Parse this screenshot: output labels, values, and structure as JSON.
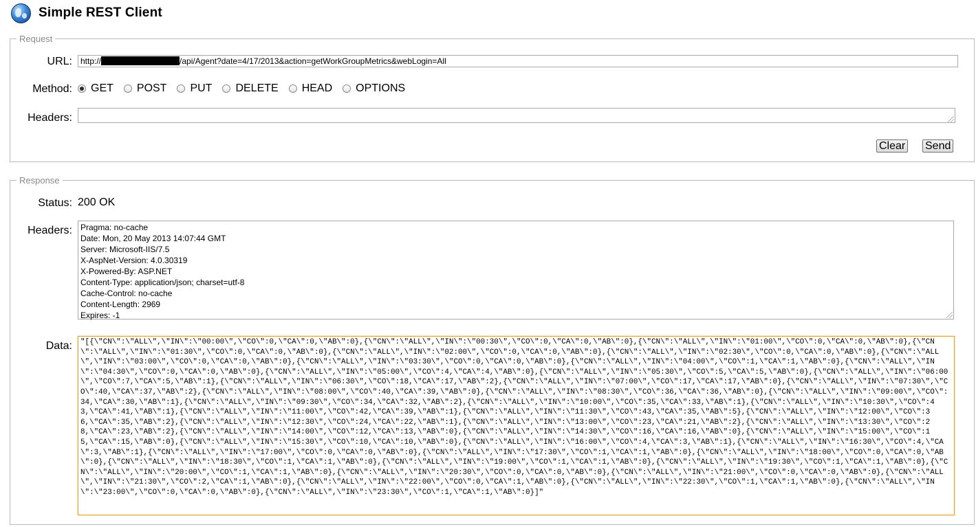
{
  "app": {
    "title": "Simple REST Client"
  },
  "request": {
    "legend": "Request",
    "url_label": "URL:",
    "url_prefix": "http://",
    "url_suffix": "/api/Agent?date=4/17/2013&action=getWorkGroupMetrics&webLogin=All",
    "method_label": "Method:",
    "methods": [
      {
        "label": "GET",
        "selected": true
      },
      {
        "label": "POST",
        "selected": false
      },
      {
        "label": "PUT",
        "selected": false
      },
      {
        "label": "DELETE",
        "selected": false
      },
      {
        "label": "HEAD",
        "selected": false
      },
      {
        "label": "OPTIONS",
        "selected": false
      }
    ],
    "headers_label": "Headers:",
    "headers_value": "",
    "clear_label": "Clear",
    "send_label": "Send"
  },
  "response": {
    "legend": "Response",
    "status_label": "Status:",
    "status_value": "200 OK",
    "headers_label": "Headers:",
    "headers": [
      "Pragma: no-cache",
      "Date: Mon, 20 May 2013 14:07:44 GMT",
      "Server: Microsoft-IIS/7.5",
      "X-AspNet-Version: 4.0.30319",
      "X-Powered-By: ASP.NET",
      "Content-Type: application/json; charset=utf-8",
      "Cache-Control: no-cache",
      "Content-Length: 2969",
      "Expires: -1"
    ],
    "data_label": "Data:",
    "data": "\"[{\\\"CN\\\":\\\"ALL\\\",\\\"IN\\\":\\\"00:00\\\",\\\"CO\\\":0,\\\"CA\\\":0,\\\"AB\\\":0},{\\\"CN\\\":\\\"ALL\\\",\\\"IN\\\":\\\"00:30\\\",\\\"CO\\\":0,\\\"CA\\\":0,\\\"AB\\\":0},{\\\"CN\\\":\\\"ALL\\\",\\\"IN\\\":\\\"01:00\\\",\\\"CO\\\":0,\\\"CA\\\":0,\\\"AB\\\":0},{\\\"CN\\\":\\\"ALL\\\",\\\"IN\\\":\\\"01:30\\\",\\\"CO\\\":0,\\\"CA\\\":0,\\\"AB\\\":0},{\\\"CN\\\":\\\"ALL\\\",\\\"IN\\\":\\\"02:00\\\",\\\"CO\\\":0,\\\"CA\\\":0,\\\"AB\\\":0},{\\\"CN\\\":\\\"ALL\\\",\\\"IN\\\":\\\"02:30\\\",\\\"CO\\\":0,\\\"CA\\\":0,\\\"AB\\\":0},{\\\"CN\\\":\\\"ALL\\\",\\\"IN\\\":\\\"03:00\\\",\\\"CO\\\":0,\\\"CA\\\":0,\\\"AB\\\":0},{\\\"CN\\\":\\\"ALL\\\",\\\"IN\\\":\\\"03:30\\\",\\\"CO\\\":0,\\\"CA\\\":0,\\\"AB\\\":0},{\\\"CN\\\":\\\"ALL\\\",\\\"IN\\\":\\\"04:00\\\",\\\"CO\\\":1,\\\"CA\\\":1,\\\"AB\\\":0},{\\\"CN\\\":\\\"ALL\\\",\\\"IN\\\":\\\"04:30\\\",\\\"CO\\\":0,\\\"CA\\\":0,\\\"AB\\\":0},{\\\"CN\\\":\\\"ALL\\\",\\\"IN\\\":\\\"05:00\\\",\\\"CO\\\":4,\\\"CA\\\":4,\\\"AB\\\":0},{\\\"CN\\\":\\\"ALL\\\",\\\"IN\\\":\\\"05:30\\\",\\\"CO\\\":5,\\\"CA\\\":5,\\\"AB\\\":0},{\\\"CN\\\":\\\"ALL\\\",\\\"IN\\\":\\\"06:00\\\",\\\"CO\\\":7,\\\"CA\\\":5,\\\"AB\\\":1},{\\\"CN\\\":\\\"ALL\\\",\\\"IN\\\":\\\"06:30\\\",\\\"CO\\\":18,\\\"CA\\\":17,\\\"AB\\\":2},{\\\"CN\\\":\\\"ALL\\\",\\\"IN\\\":\\\"07:00\\\",\\\"CO\\\":17,\\\"CA\\\":17,\\\"AB\\\":0},{\\\"CN\\\":\\\"ALL\\\",\\\"IN\\\":\\\"07:30\\\",\\\"CO\\\":40,\\\"CA\\\":37,\\\"AB\\\":2},{\\\"CN\\\":\\\"ALL\\\",\\\"IN\\\":\\\"08:00\\\",\\\"CO\\\":40,\\\"CA\\\":39,\\\"AB\\\":0},{\\\"CN\\\":\\\"ALL\\\",\\\"IN\\\":\\\"08:30\\\",\\\"CO\\\":36,\\\"CA\\\":36,\\\"AB\\\":0},{\\\"CN\\\":\\\"ALL\\\",\\\"IN\\\":\\\"09:00\\\",\\\"CO\\\":34,\\\"CA\\\":30,\\\"AB\\\":1},{\\\"CN\\\":\\\"ALL\\\",\\\"IN\\\":\\\"09:30\\\",\\\"CO\\\":34,\\\"CA\\\":32,\\\"AB\\\":2},{\\\"CN\\\":\\\"ALL\\\",\\\"IN\\\":\\\"10:00\\\",\\\"CO\\\":35,\\\"CA\\\":33,\\\"AB\\\":1},{\\\"CN\\\":\\\"ALL\\\",\\\"IN\\\":\\\"10:30\\\",\\\"CO\\\":43,\\\"CA\\\":41,\\\"AB\\\":1},{\\\"CN\\\":\\\"ALL\\\",\\\"IN\\\":\\\"11:00\\\",\\\"CO\\\":42,\\\"CA\\\":39,\\\"AB\\\":1},{\\\"CN\\\":\\\"ALL\\\",\\\"IN\\\":\\\"11:30\\\",\\\"CO\\\":43,\\\"CA\\\":35,\\\"AB\\\":5},{\\\"CN\\\":\\\"ALL\\\",\\\"IN\\\":\\\"12:00\\\",\\\"CO\\\":36,\\\"CA\\\":35,\\\"AB\\\":2},{\\\"CN\\\":\\\"ALL\\\",\\\"IN\\\":\\\"12:30\\\",\\\"CO\\\":24,\\\"CA\\\":22,\\\"AB\\\":1},{\\\"CN\\\":\\\"ALL\\\",\\\"IN\\\":\\\"13:00\\\",\\\"CO\\\":23,\\\"CA\\\":21,\\\"AB\\\":2},{\\\"CN\\\":\\\"ALL\\\",\\\"IN\\\":\\\"13:30\\\",\\\"CO\\\":28,\\\"CA\\\":23,\\\"AB\\\":2},{\\\"CN\\\":\\\"ALL\\\",\\\"IN\\\":\\\"14:00\\\",\\\"CO\\\":12,\\\"CA\\\":13,\\\"AB\\\":0},{\\\"CN\\\":\\\"ALL\\\",\\\"IN\\\":\\\"14:30\\\",\\\"CO\\\":16,\\\"CA\\\":16,\\\"AB\\\":0},{\\\"CN\\\":\\\"ALL\\\",\\\"IN\\\":\\\"15:00\\\",\\\"CO\\\":15,\\\"CA\\\":15,\\\"AB\\\":0},{\\\"CN\\\":\\\"ALL\\\",\\\"IN\\\":\\\"15:30\\\",\\\"CO\\\":10,\\\"CA\\\":10,\\\"AB\\\":0},{\\\"CN\\\":\\\"ALL\\\",\\\"IN\\\":\\\"16:00\\\",\\\"CO\\\":4,\\\"CA\\\":3,\\\"AB\\\":1},{\\\"CN\\\":\\\"ALL\\\",\\\"IN\\\":\\\"16:30\\\",\\\"CO\\\":4,\\\"CA\\\":3,\\\"AB\\\":1},{\\\"CN\\\":\\\"ALL\\\",\\\"IN\\\":\\\"17:00\\\",\\\"CO\\\":0,\\\"CA\\\":0,\\\"AB\\\":0},{\\\"CN\\\":\\\"ALL\\\",\\\"IN\\\":\\\"17:30\\\",\\\"CO\\\":1,\\\"CA\\\":1,\\\"AB\\\":0},{\\\"CN\\\":\\\"ALL\\\",\\\"IN\\\":\\\"18:00\\\",\\\"CO\\\":0,\\\"CA\\\":0,\\\"AB\\\":0},{\\\"CN\\\":\\\"ALL\\\",\\\"IN\\\":\\\"18:30\\\",\\\"CO\\\":1,\\\"CA\\\":1,\\\"AB\\\":0},{\\\"CN\\\":\\\"ALL\\\",\\\"IN\\\":\\\"19:00\\\",\\\"CO\\\":1,\\\"CA\\\":1,\\\"AB\\\":0},{\\\"CN\\\":\\\"ALL\\\",\\\"IN\\\":\\\"19:30\\\",\\\"CO\\\":1,\\\"CA\\\":1,\\\"AB\\\":0},{\\\"CN\\\":\\\"ALL\\\",\\\"IN\\\":\\\"20:00\\\",\\\"CO\\\":1,\\\"CA\\\":1,\\\"AB\\\":0},{\\\"CN\\\":\\\"ALL\\\",\\\"IN\\\":\\\"20:30\\\",\\\"CO\\\":0,\\\"CA\\\":0,\\\"AB\\\":0},{\\\"CN\\\":\\\"ALL\\\",\\\"IN\\\":\\\"21:00\\\",\\\"CO\\\":0,\\\"CA\\\":0,\\\"AB\\\":0},{\\\"CN\\\":\\\"ALL\\\",\\\"IN\\\":\\\"21:30\\\",\\\"CO\\\":2,\\\"CA\\\":1,\\\"AB\\\":0},{\\\"CN\\\":\\\"ALL\\\",\\\"IN\\\":\\\"22:00\\\",\\\"CO\\\":0,\\\"CA\\\":1,\\\"AB\\\":0},{\\\"CN\\\":\\\"ALL\\\",\\\"IN\\\":\\\"22:30\\\",\\\"CO\\\":1,\\\"CA\\\":1,\\\"AB\\\":0},{\\\"CN\\\":\\\"ALL\\\",\\\"IN\\\":\\\"23:00\\\",\\\"CO\\\":0,\\\"CA\\\":0,\\\"AB\\\":0},{\\\"CN\\\":\\\"ALL\\\",\\\"IN\\\":\\\"23:30\\\",\\\"CO\\\":1,\\\"CA\\\":1,\\\"AB\\\":0}]\""
  }
}
